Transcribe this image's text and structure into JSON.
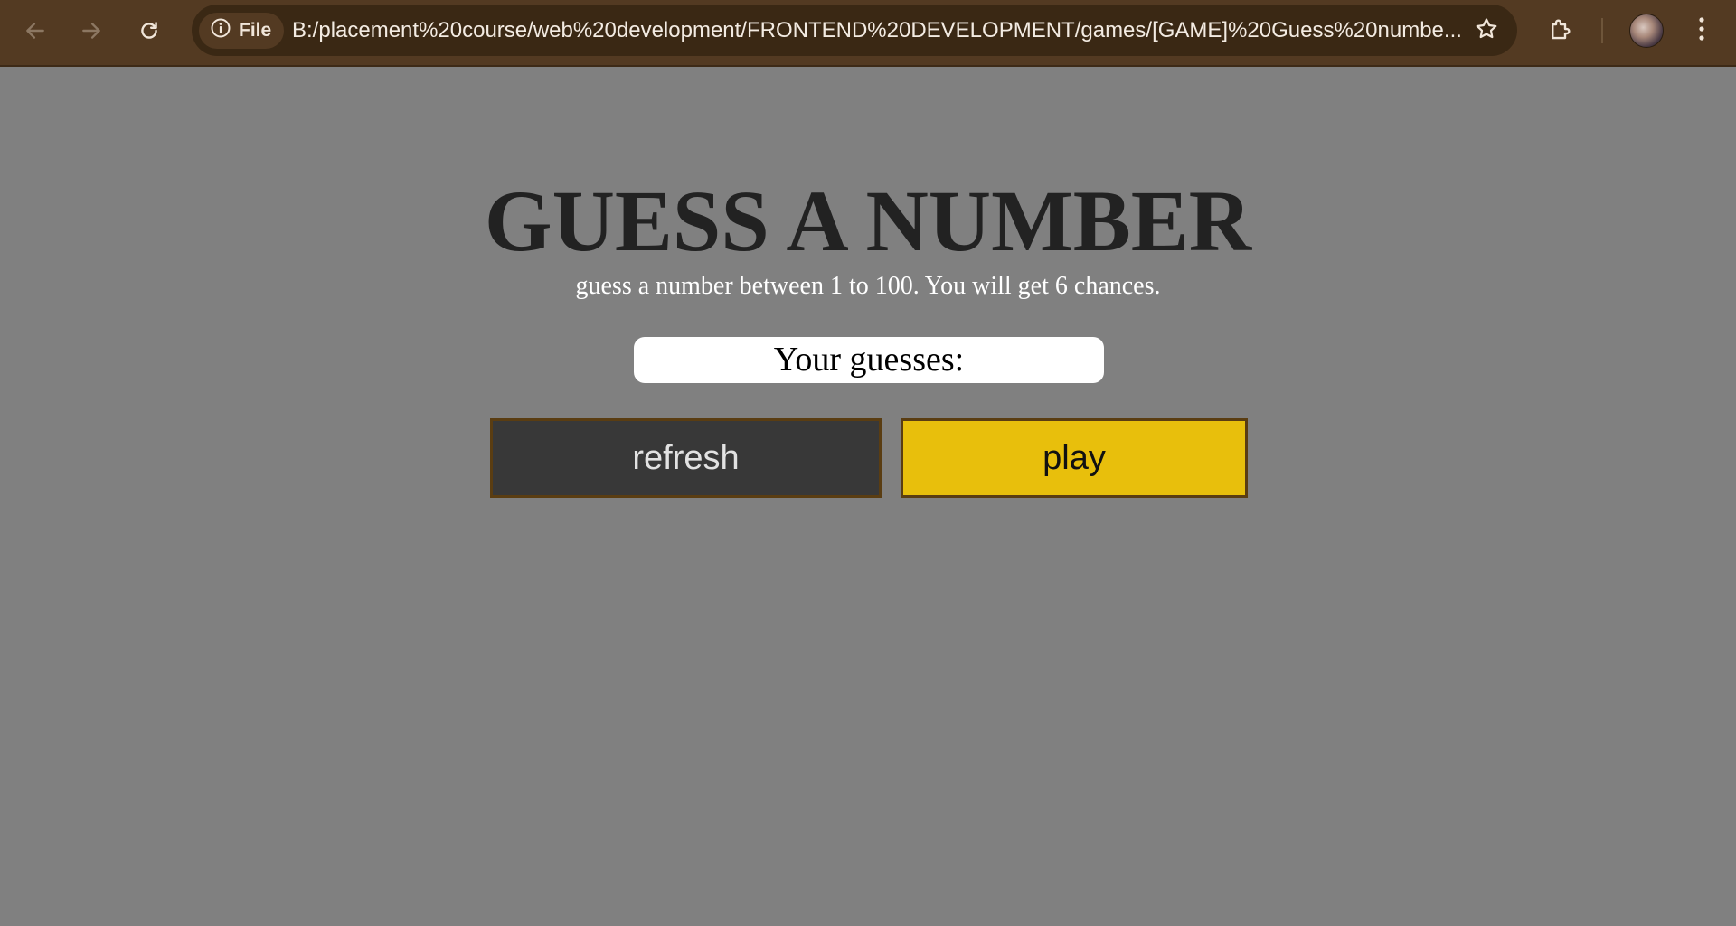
{
  "browser": {
    "site_chip_label": "File",
    "url": "B:/placement%20course/web%20development/FRONTEND%20DEVELOPMENT/games/[GAME]%20Guess%20numbe...",
    "icons": {
      "back": "back-arrow-icon",
      "forward": "forward-arrow-icon",
      "reload": "reload-icon",
      "site_info": "info-icon",
      "bookmark": "star-icon",
      "extensions": "puzzle-icon",
      "menu": "kebab-menu-icon"
    },
    "colors": {
      "toolbar": "#533a22",
      "omnibox": "#3a2814"
    }
  },
  "game": {
    "title": "GUESS A NUMBER",
    "instructions": "guess a number between 1 to 100. You will get 6 chances.",
    "guesses_label": "Your guesses:",
    "refresh_label": "refresh",
    "play_label": "play",
    "colors": {
      "page_background": "#808080",
      "title": "#222222",
      "refresh_button": "#383838",
      "play_button": "#e8bf0c",
      "button_border": "#5a3d12"
    }
  }
}
